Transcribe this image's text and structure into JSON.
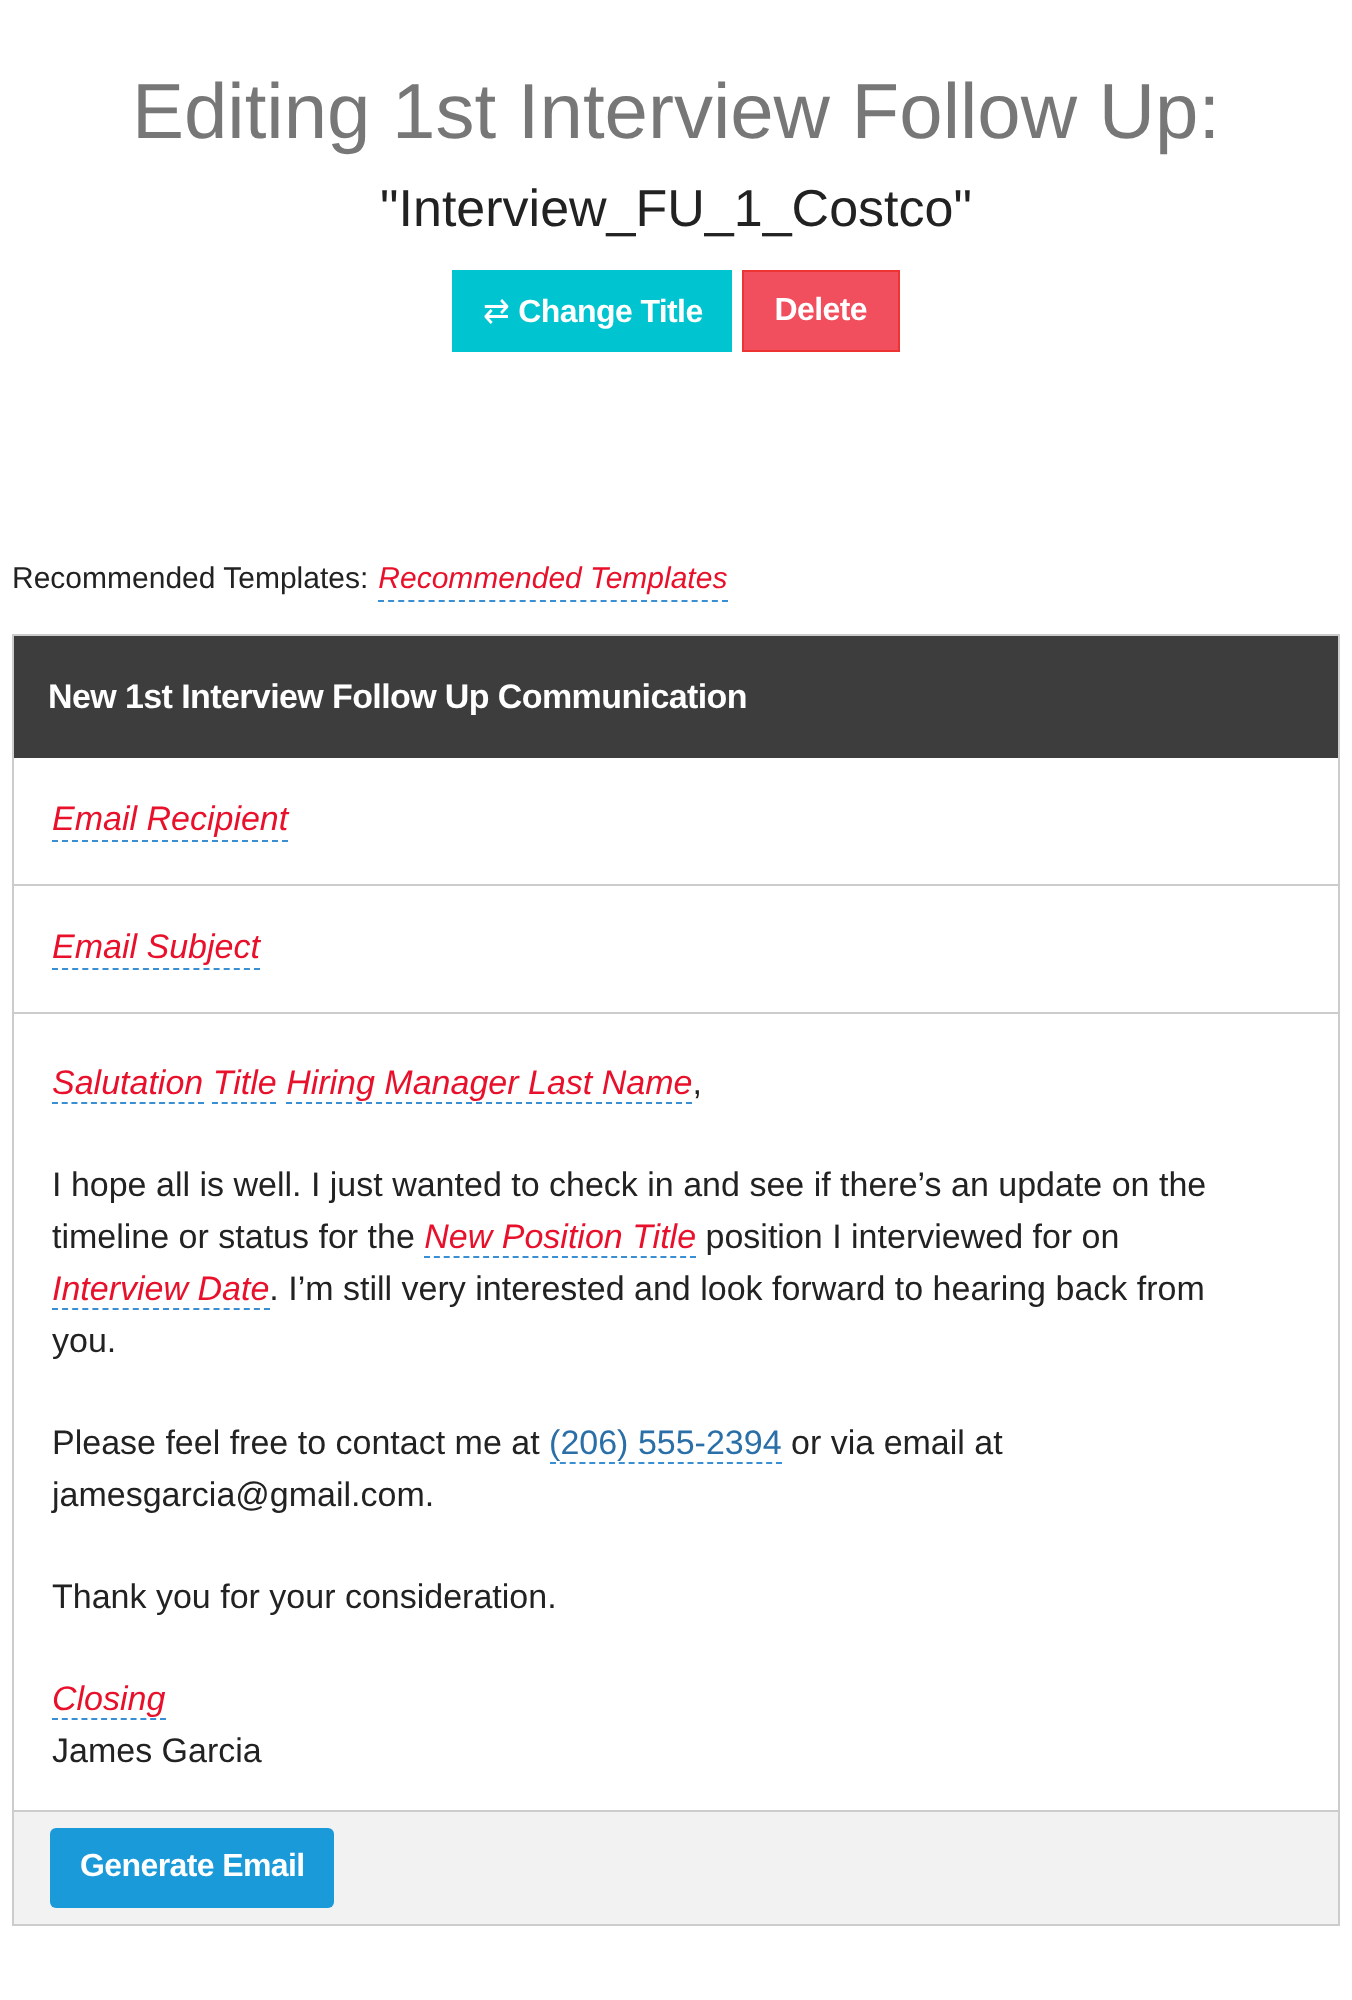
{
  "heading": {
    "title": "Editing 1st Interview Follow Up:",
    "subtitle": "\"Interview_FU_1_Costco\""
  },
  "actions": [
    {
      "kind": "change",
      "icon": "⇄",
      "label": "Change Title"
    },
    {
      "kind": "delete",
      "label": "Delete"
    }
  ],
  "recommended": {
    "label": "Recommended Templates:",
    "value": "Recommended Templates"
  },
  "card": {
    "title": "New 1st Interview Follow Up Communication",
    "fields": [
      {
        "label": "Email Recipient"
      },
      {
        "label": "Email Subject"
      }
    ],
    "paragraphs": [
      [
        {
          "kind": "placeholder",
          "text": "Salutation"
        },
        {
          "kind": "space"
        },
        {
          "kind": "placeholder",
          "text": "Title"
        },
        {
          "kind": "space"
        },
        {
          "kind": "placeholder",
          "text": "Hiring Manager Last Name"
        },
        {
          "kind": "text",
          "text": ","
        }
      ],
      [
        {
          "kind": "text",
          "text": "I hope all is well. I just wanted to check in and see if there’s an update on the timeline or status for the "
        },
        {
          "kind": "placeholder",
          "text": "New Position Title"
        },
        {
          "kind": "text",
          "text": " position I interviewed for on "
        },
        {
          "kind": "placeholder",
          "text": "Interview Date"
        },
        {
          "kind": "text",
          "text": ". I’m still very interested and look forward to hearing back from you."
        }
      ],
      [
        {
          "kind": "text",
          "text": "Please feel free to contact me at "
        },
        {
          "kind": "filled",
          "text": "(206) 555-2394"
        },
        {
          "kind": "text",
          "text": " or via email at jamesgarcia@gmail.com."
        }
      ],
      [
        {
          "kind": "text",
          "text": "Thank you for your consideration."
        }
      ],
      [
        {
          "kind": "placeholder",
          "text": "Closing"
        },
        {
          "kind": "break"
        },
        {
          "kind": "text",
          "text": "James Garcia"
        }
      ]
    ],
    "submit": "Generate Email"
  }
}
